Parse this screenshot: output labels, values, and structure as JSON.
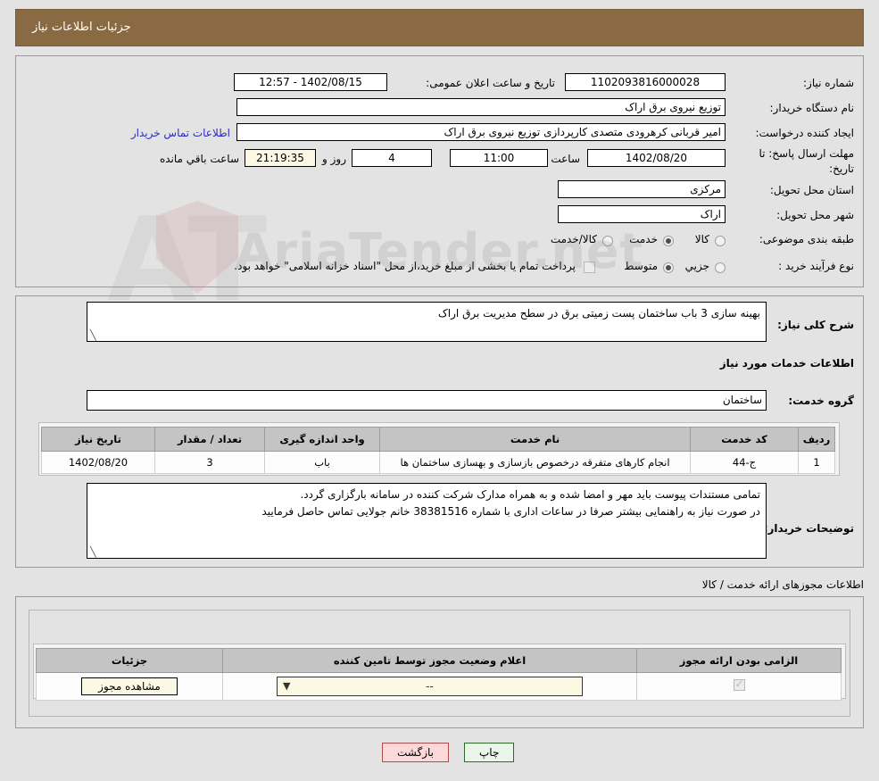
{
  "header": {
    "title": "جزئیات اطلاعات نیاز",
    "bar_color": "#8a6a42"
  },
  "watermark": {
    "text": "AriaTender.net"
  },
  "top_form": {
    "need_number_label": "شماره نیاز:",
    "need_number_value": "1102093816000028",
    "announce_datetime_label": "تاریخ و ساعت اعلان عمومی:",
    "announce_datetime_value": "1402/08/15 - 12:57",
    "buyer_org_label": "نام دستگاه خریدار:",
    "buyer_org_value": "توزیع نیروی برق اراک",
    "creator_label": "ایجاد کننده درخواست:",
    "creator_value": "امیر قربانی کرهرودی متصدی کارپردازی توزیع نیروی برق اراک",
    "contact_link": "اطلاعات تماس خریدار",
    "deadline_label": "مهلت ارسال پاسخ: تا تاریخ:",
    "deadline_date": "1402/08/20",
    "hour_label": "ساعت",
    "hour_value": "11:00",
    "days_value": "4",
    "days_word": "روز و",
    "remaining_time": "21:19:35",
    "remaining_suffix": "ساعت باقي مانده",
    "province_label": "استان محل تحویل:",
    "province_value": "مرکزی",
    "city_label": "شهر محل تحویل:",
    "city_value": "اراک",
    "classification_label": "طبقه بندی موضوعی:",
    "classification_options": [
      {
        "label": "کالا",
        "selected": false
      },
      {
        "label": "خدمت",
        "selected": true
      },
      {
        "label": "کالا/خدمت",
        "selected": false
      }
    ],
    "purchase_type_label": "نوع فرآیند خرید :",
    "purchase_type_options": [
      {
        "label": "جزیي",
        "selected": false
      },
      {
        "label": "متوسط",
        "selected": true
      }
    ],
    "treasury_checkbox_checked": false,
    "treasury_note": "پرداخت تمام یا بخشی از مبلغ خرید،از محل \"اسناد خزانه اسلامی\" خواهد بود."
  },
  "description_section": {
    "general_need_label": "شرح کلی نیاز:",
    "general_need_value": "بهینه سازی 3 باب ساختمان پست زمیتی برق در سطح مدیریت برق اراک",
    "services_info_heading": "اطلاعات خدمات مورد نیاز",
    "service_group_label": "گروه خدمت:",
    "service_group_value": "ساختمان"
  },
  "services_table": {
    "columns": [
      "ردیف",
      "کد خدمت",
      "نام خدمت",
      "واحد اندازه گیری",
      "تعداد / مقدار",
      "تاریخ نیاز"
    ],
    "rows": [
      {
        "row": "1",
        "code": "ج-44",
        "name": "انجام کارهای متفرقه درخصوص بازسازی و بهسازی ساختمان ها",
        "unit": "باب",
        "quantity": "3",
        "need_date": "1402/08/20"
      }
    ]
  },
  "buyer_notes": {
    "label": "توضیحات خریدار:",
    "line1": "تمامی مستندات پیوست باید مهر و امضا شده و به همراه مدارک شرکت کننده در سامانه بارگزاری گردد.",
    "line2": "در صورت نیاز به راهنمایی بیشتر صرفا در ساعات اداری با شماره 38381516 خانم جولایی تماس حاصل فرمایید"
  },
  "licenses_section": {
    "heading": "اطلاعات مجوزهای ارائه خدمت / کالا",
    "columns": [
      "الزامی بودن ارائه مجوز",
      "اعلام وضعیت مجوز توسط تامین کننده",
      "جزئیات"
    ],
    "rows": [
      {
        "required_checked": true,
        "status_value": "--",
        "details_button": "مشاهده مجوز"
      }
    ]
  },
  "footer": {
    "print_button": "چاپ",
    "back_button": "بازگشت"
  }
}
